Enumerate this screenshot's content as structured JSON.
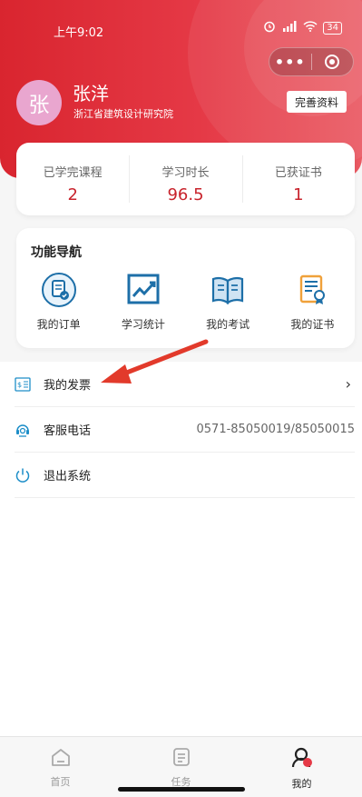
{
  "status_bar": {
    "time": "上午9:02",
    "battery": "34"
  },
  "header": {
    "avatar_text": "张",
    "name": "张洋",
    "organization": "浙江省建筑设计研究院",
    "complete_profile_button": "完善资料"
  },
  "stats": [
    {
      "label": "已学完课程",
      "value": "2"
    },
    {
      "label": "学习时长",
      "value": "96.5"
    },
    {
      "label": "已获证书",
      "value": "1"
    }
  ],
  "functions": {
    "title": "功能导航",
    "items": [
      {
        "label": "我的订单",
        "icon": "order-icon"
      },
      {
        "label": "学习统计",
        "icon": "chart-icon"
      },
      {
        "label": "我的考试",
        "icon": "book-icon"
      },
      {
        "label": "我的证书",
        "icon": "certificate-icon"
      }
    ]
  },
  "menu": [
    {
      "label": "我的发票",
      "icon": "invoice-icon",
      "right": ""
    },
    {
      "label": "客服电话",
      "icon": "customer-service-icon",
      "right": "0571-85050019/85050015"
    },
    {
      "label": "退出系统",
      "icon": "power-icon",
      "right": ""
    }
  ],
  "tabbar": [
    {
      "label": "首页",
      "icon": "home-icon",
      "active": false
    },
    {
      "label": "任务",
      "icon": "task-icon",
      "active": false
    },
    {
      "label": "我的",
      "icon": "profile-icon",
      "active": true
    }
  ],
  "colors": {
    "brand_red": "#e53946",
    "value_red": "#c8232c",
    "icon_blue": "#1d6fa8",
    "icon_orange": "#f0a13a",
    "arrow_red": "#e23a2b"
  }
}
